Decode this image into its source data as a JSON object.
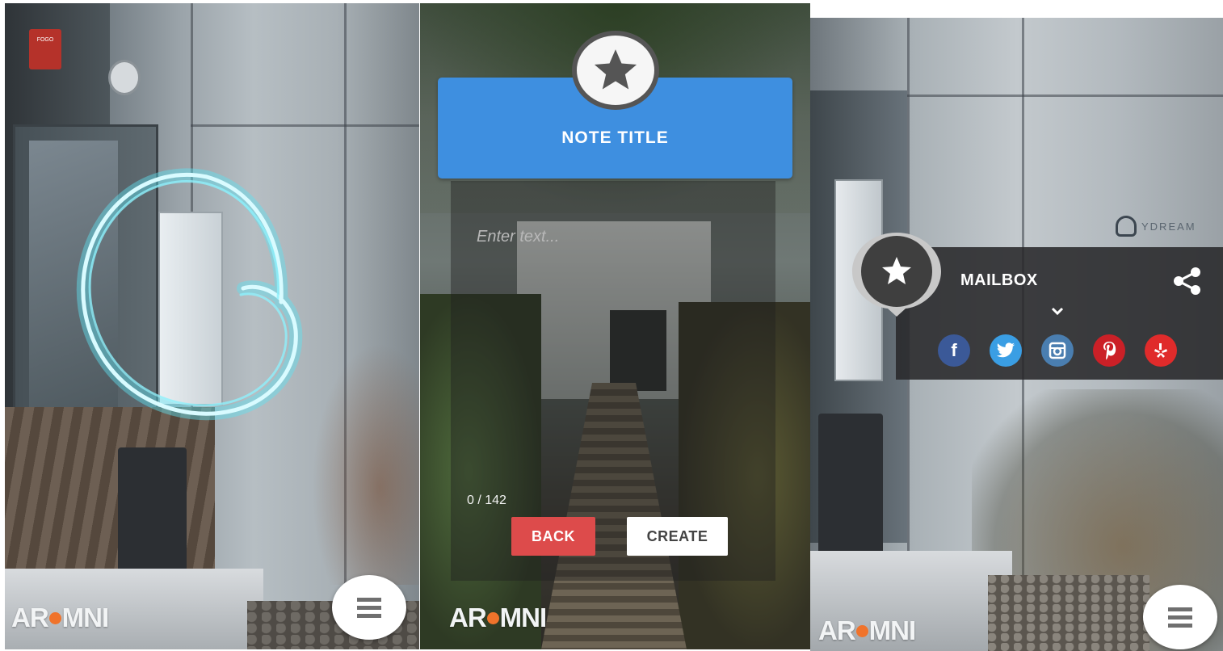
{
  "brand": {
    "logo_left": "AR",
    "logo_right": "MNI",
    "accent": "#f0732b"
  },
  "panels": [
    {
      "id": "draw-mode",
      "wall_sign": "FOGO",
      "menu_icon": "hamburger-icon"
    },
    {
      "id": "create-note",
      "note": {
        "title": "NOTE TITLE",
        "placeholder": "Enter text...",
        "char_count": "0 / 142",
        "header_color": "#3e8fe0",
        "badge_icon": "star-icon"
      },
      "buttons": {
        "back": "BACK",
        "create": "CREATE",
        "back_color": "#dd4b4b"
      }
    },
    {
      "id": "poi-view",
      "wall_brand": "YDREAM",
      "poi": {
        "title": "MAILBOX",
        "share_icon": "share-icon",
        "expand_icon": "chevron-down-icon",
        "pin_icon": "star-icon"
      },
      "social": [
        {
          "name": "facebook",
          "glyph": "f",
          "color": "#3b5998"
        },
        {
          "name": "twitter",
          "glyph": "t",
          "color": "#3a9ee4"
        },
        {
          "name": "instagram",
          "glyph": "ig",
          "color": "#4a7eb0"
        },
        {
          "name": "pinterest",
          "glyph": "p",
          "color": "#cb2027"
        },
        {
          "name": "yelp",
          "glyph": "y",
          "color": "#e02b2b"
        }
      ],
      "menu_icon": "hamburger-icon"
    }
  ]
}
